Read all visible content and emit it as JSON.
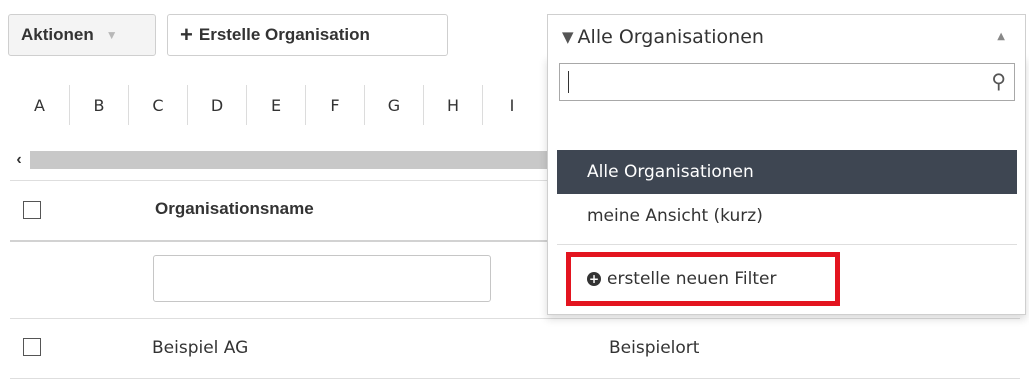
{
  "toolbar": {
    "actions_label": "Aktionen",
    "create_label": "Erstelle Organisation"
  },
  "letters": [
    "A",
    "B",
    "C",
    "D",
    "E",
    "F",
    "G",
    "H",
    "I"
  ],
  "table": {
    "header_name": "Organisationsname",
    "rows": [
      {
        "name": "Beispiel AG",
        "city": "Beispielort"
      }
    ]
  },
  "view_select": {
    "selected": "Alle Organisationen",
    "search_value": "",
    "options": [
      "Alle Organisationen",
      "meine Ansicht (kurz)"
    ],
    "new_filter_label": "erstelle neuen Filter"
  },
  "colors": {
    "highlight_bg": "#3e4652",
    "callout_border": "#e3141f"
  },
  "icons": {
    "caret": "chevron-down-icon",
    "plus": "plus-icon",
    "funnel": "filter-icon",
    "up": "chevron-up-icon",
    "search": "search-icon",
    "add_circle": "add-circle-icon",
    "scroll_left": "chevron-left-icon"
  }
}
